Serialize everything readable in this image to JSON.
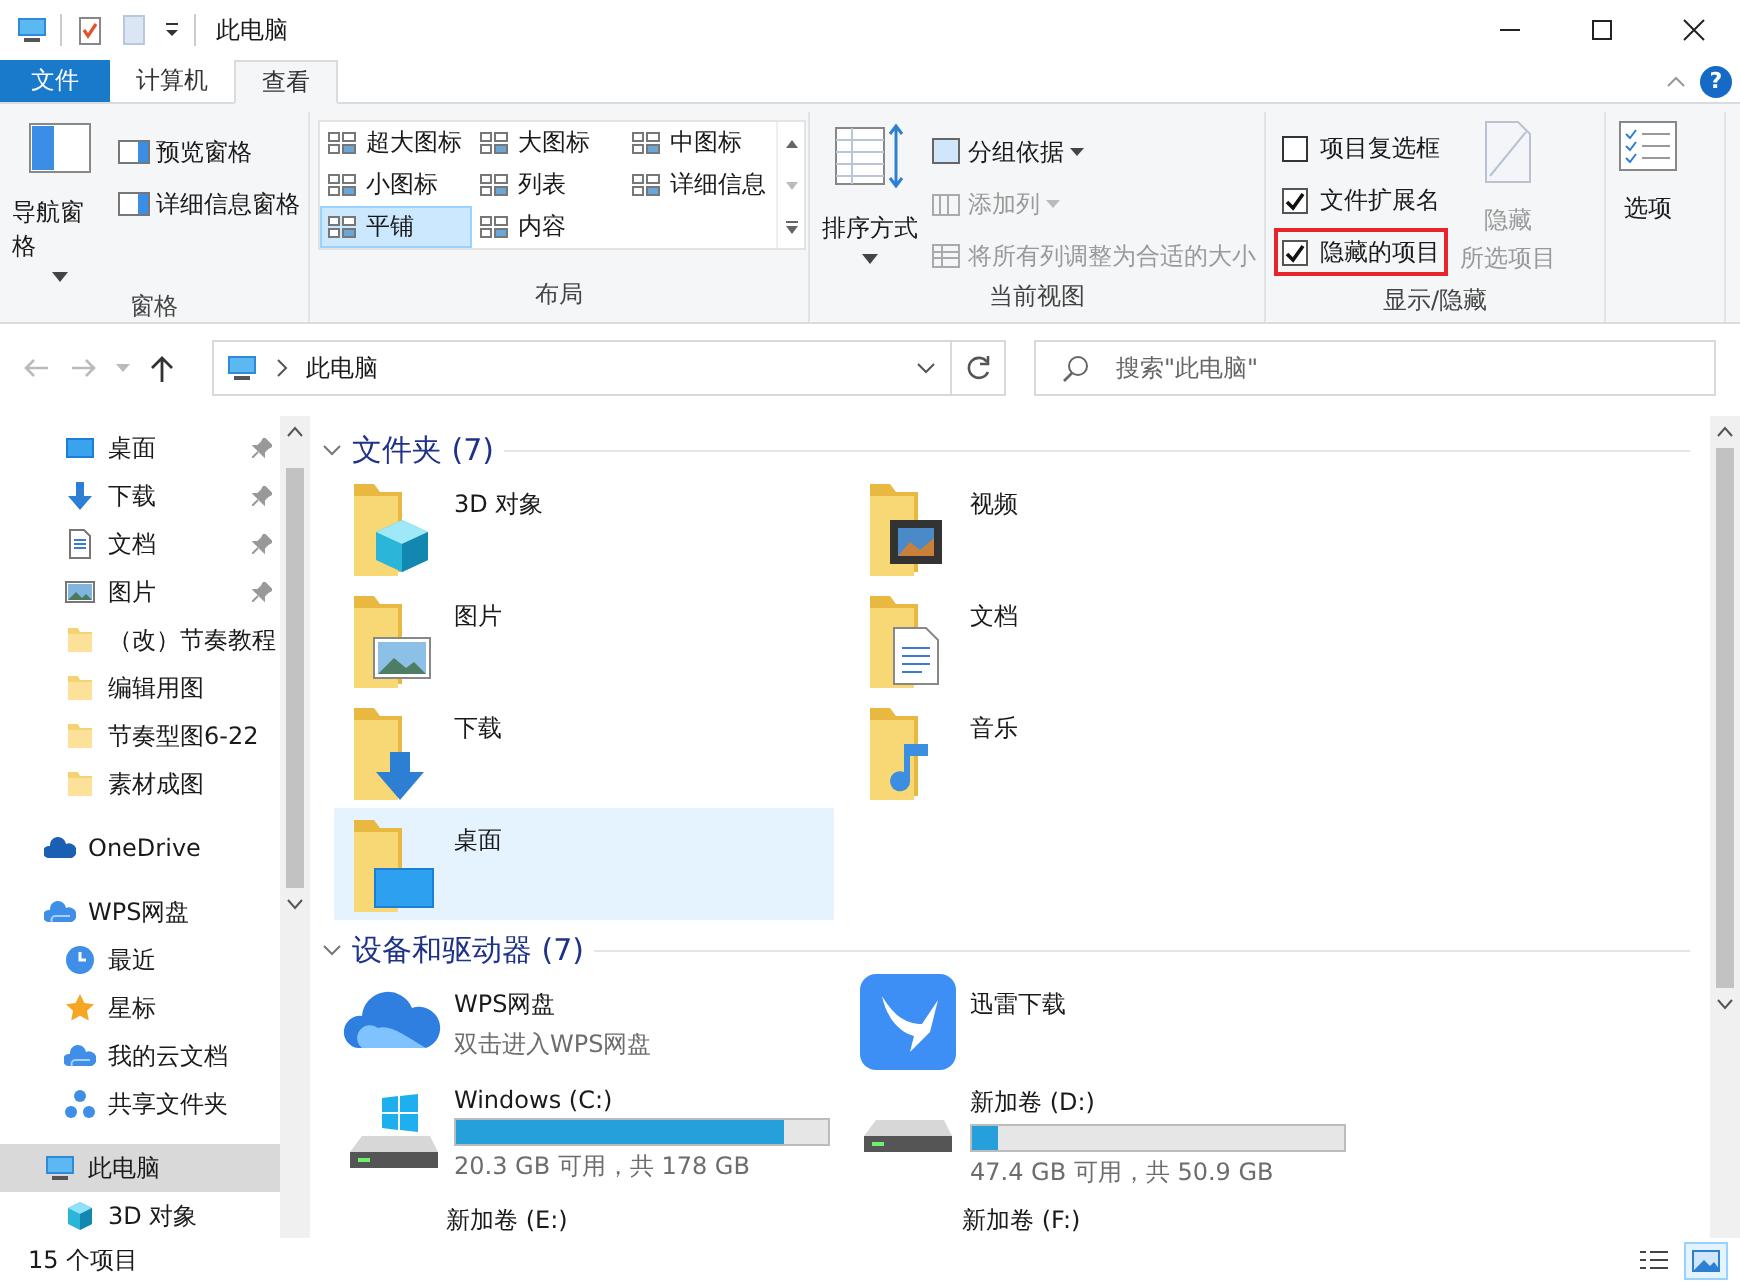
{
  "title_bar": {
    "title": "此电脑"
  },
  "ribbon_tabs": [
    {
      "label": "文件",
      "kind": "file",
      "selected": false
    },
    {
      "label": "计算机",
      "kind": "tab",
      "selected": false
    },
    {
      "label": "查看",
      "kind": "tab",
      "selected": true
    }
  ],
  "help": {
    "label": "?"
  },
  "ribbon": {
    "panes": {
      "label": "窗格",
      "big": {
        "label": "导航窗格"
      },
      "items": [
        {
          "label": "预览窗格"
        },
        {
          "label": "详细信息窗格"
        }
      ]
    },
    "layout": {
      "label": "布局",
      "options": [
        {
          "label": "超大图标",
          "selected": false
        },
        {
          "label": "大图标",
          "selected": false
        },
        {
          "label": "中图标",
          "selected": false
        },
        {
          "label": "小图标",
          "selected": false
        },
        {
          "label": "列表",
          "selected": false
        },
        {
          "label": "详细信息",
          "selected": false
        },
        {
          "label": "平铺",
          "selected": true
        },
        {
          "label": "内容",
          "selected": false
        }
      ]
    },
    "current_view": {
      "label": "当前视图",
      "big": {
        "label": "排序方式"
      },
      "items": [
        {
          "label": "分组依据",
          "disabled": false,
          "dropdown": true
        },
        {
          "label": "添加列",
          "disabled": true,
          "dropdown": true
        },
        {
          "label": "将所有列调整为合适的大小",
          "disabled": true,
          "dropdown": false
        }
      ]
    },
    "show_hide": {
      "label": "显示/隐藏",
      "checkboxes": [
        {
          "label": "项目复选框",
          "checked": false,
          "highlighted": false
        },
        {
          "label": "文件扩展名",
          "checked": true,
          "highlighted": false
        },
        {
          "label": "隐藏的项目",
          "checked": true,
          "highlighted": true
        }
      ],
      "hide_selected": {
        "lines": [
          "隐藏",
          "所选项目"
        ],
        "disabled": true
      }
    },
    "options": {
      "label": "选项"
    }
  },
  "address_bar": {
    "path": "此电脑",
    "search_placeholder": "搜索\"此电脑\""
  },
  "nav_pane": {
    "items": [
      {
        "children": [
          {
            "label": "桌面",
            "kind": "desktop",
            "pinned": true,
            "selected": false
          },
          {
            "label": "下载",
            "kind": "download",
            "pinned": true,
            "selected": false
          },
          {
            "label": "文档",
            "kind": "document",
            "pinned": true,
            "selected": false
          },
          {
            "label": "图片",
            "kind": "picture",
            "pinned": true,
            "selected": false
          },
          {
            "label": "（改）节奏教程",
            "kind": "folder",
            "pinned": false,
            "selected": false
          },
          {
            "label": "编辑用图",
            "kind": "folder",
            "pinned": false,
            "selected": false
          },
          {
            "label": "节奏型图6-22",
            "kind": "folder",
            "pinned": false,
            "selected": false
          },
          {
            "label": "素材成图",
            "kind": "folder",
            "pinned": false,
            "selected": false
          }
        ]
      },
      {
        "label": "OneDrive",
        "kind": "onedrive",
        "selected": false
      },
      {
        "label": "WPS网盘",
        "kind": "cloud",
        "selected": false,
        "children": [
          {
            "label": "最近",
            "kind": "clock",
            "selected": false
          },
          {
            "label": "星标",
            "kind": "star",
            "selected": false
          },
          {
            "label": "我的云文档",
            "kind": "cloud",
            "selected": false
          },
          {
            "label": "共享文件夹",
            "kind": "share",
            "selected": false
          }
        ]
      },
      {
        "label": "此电脑",
        "kind": "computer",
        "selected": true,
        "children": [
          {
            "label": "3D 对象",
            "kind": "cube",
            "selected": false
          }
        ]
      }
    ]
  },
  "content": {
    "sections": [
      {
        "title": "文件夹 (7)",
        "items": [
          {
            "name": "3D 对象",
            "kind": "cube",
            "selected": false
          },
          {
            "name": "视频",
            "kind": "film",
            "selected": false
          },
          {
            "name": "图片",
            "kind": "picture",
            "selected": false
          },
          {
            "name": "文档",
            "kind": "document",
            "selected": false
          },
          {
            "name": "下载",
            "kind": "download",
            "selected": false
          },
          {
            "name": "音乐",
            "kind": "music",
            "selected": false
          },
          {
            "name": "桌面",
            "kind": "desktop",
            "selected": true
          }
        ]
      },
      {
        "title": "设备和驱动器 (7)",
        "items": [
          {
            "name": "WPS网盘",
            "kind": "cloud-app",
            "subtitle": "双击进入WPS网盘",
            "selected": false
          },
          {
            "name": "迅雷下载",
            "kind": "bird-app",
            "selected": false
          },
          {
            "name": "Windows (C:)",
            "kind": "system-drive",
            "level": 0.88,
            "reading": "20.3 GB 可用，共 178 GB",
            "selected": false
          },
          {
            "name": "新加卷 (D:)",
            "kind": "drive",
            "level": 0.07,
            "reading": "47.4 GB 可用，共 50.9 GB",
            "selected": false
          },
          {
            "name": "新加卷 (E:)",
            "kind": "partial",
            "selected": false
          },
          {
            "name": "新加卷 (F:)",
            "kind": "partial",
            "selected": false
          }
        ]
      }
    ]
  },
  "status_bar": {
    "count": "15 个项目",
    "view_modes": [
      {
        "kind": "details",
        "selected": false
      },
      {
        "kind": "tiles",
        "selected": true
      }
    ]
  }
}
